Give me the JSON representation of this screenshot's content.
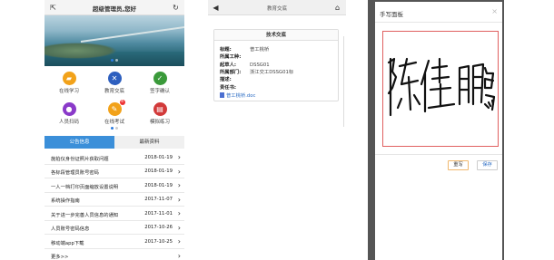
{
  "home": {
    "title": "超级管理员,您好",
    "back_icon": "external-link-icon",
    "refresh_icon": "refresh-icon",
    "tiles": [
      {
        "label": "在线学习",
        "color": "#f2a21a",
        "icon": "folder-icon",
        "glyph": "▰",
        "badge": ""
      },
      {
        "label": "教育交底",
        "color": "#2d5fbf",
        "icon": "tools-icon",
        "glyph": "✕",
        "badge": ""
      },
      {
        "label": "签字确认",
        "color": "#3a9a3a",
        "icon": "check-shield-icon",
        "glyph": "✓",
        "badge": ""
      },
      {
        "label": "人员扫码",
        "color": "#8a3ac9",
        "icon": "location-pin-icon",
        "glyph": "●",
        "badge": ""
      },
      {
        "label": "在线考试",
        "color": "#f2a21a",
        "icon": "exam-icon",
        "glyph": "✎",
        "badge": "4"
      },
      {
        "label": "模拟练习",
        "color": "#d23a3a",
        "icon": "book-icon",
        "glyph": "▤",
        "badge": ""
      }
    ],
    "tabs": [
      {
        "label": "公告信息",
        "active": true
      },
      {
        "label": "最新资料",
        "active": false
      }
    ],
    "news": [
      {
        "title": "施拍仪身份证照片获取问题",
        "date": "2018-01-19"
      },
      {
        "title": "各标段管理员账号密码",
        "date": "2018-01-19"
      },
      {
        "title": "一人一档打印页面缩放设置说明",
        "date": "2018-01-19"
      },
      {
        "title": "系统操作指南",
        "date": "2017-11-07"
      },
      {
        "title": "关于进一步完善人员信息的通知",
        "date": "2017-11-01"
      },
      {
        "title": "人员账号密码信息",
        "date": "2017-10-26"
      },
      {
        "title": "移动端app下载",
        "date": "2017-10-25"
      },
      {
        "title": "更多>>",
        "date": ""
      }
    ]
  },
  "detail": {
    "header_title": "教育交底",
    "card_title": "技术交底",
    "fields": [
      {
        "key": "标题:",
        "value": "普工桃桥"
      },
      {
        "key": "所属工种:",
        "value": ""
      },
      {
        "key": "起草人:",
        "value": "DSSG01"
      },
      {
        "key": "所属部门:",
        "value": "浙江交工DSSG01标"
      },
      {
        "key": "描述:",
        "value": ""
      },
      {
        "key": "责任书:",
        "value": ""
      }
    ],
    "attachment": "普工桃桥.doc"
  },
  "signature": {
    "title": "手写面板",
    "close": "×",
    "handwriting": "陈佳鹏",
    "redo_label": "重写",
    "save_label": "保存"
  },
  "colors": {
    "tab_active": "#3b8fd9",
    "link": "#2b6cc4",
    "pad_border": "#e06060",
    "redo_border": "#f0b86e"
  }
}
